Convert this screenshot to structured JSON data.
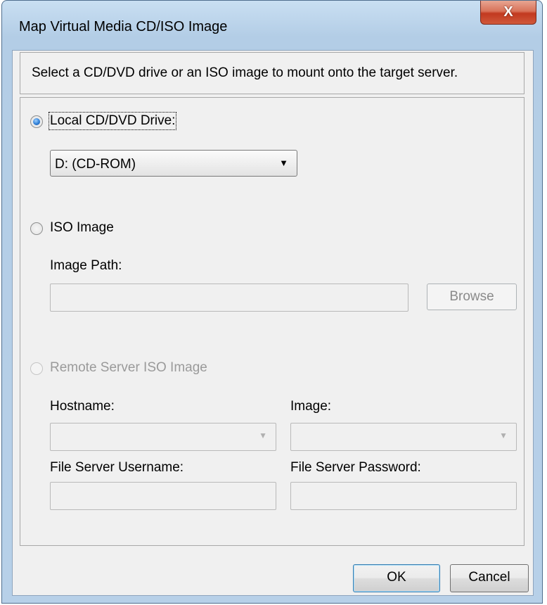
{
  "window": {
    "title": "Map Virtual Media CD/ISO Image",
    "close_glyph": "X"
  },
  "description": "Select a CD/DVD drive or an ISO image to mount onto the target server.",
  "local": {
    "label": "Local CD/DVD Drive:",
    "selected": true,
    "drive_value": "D: (CD-ROM)"
  },
  "iso": {
    "label": "ISO Image",
    "selected": false,
    "path_label": "Image Path:",
    "path_value": "",
    "browse_label": "Browse"
  },
  "remote": {
    "label": "Remote Server ISO Image",
    "selected": false,
    "enabled": false,
    "hostname_label": "Hostname:",
    "hostname_value": "",
    "image_label": "Image:",
    "image_value": "",
    "username_label": "File Server Username:",
    "username_value": "",
    "password_label": "File Server Password:",
    "password_value": ""
  },
  "buttons": {
    "ok": "OK",
    "cancel": "Cancel"
  },
  "icons": {
    "dropdown": "▼",
    "combo": "▼"
  }
}
